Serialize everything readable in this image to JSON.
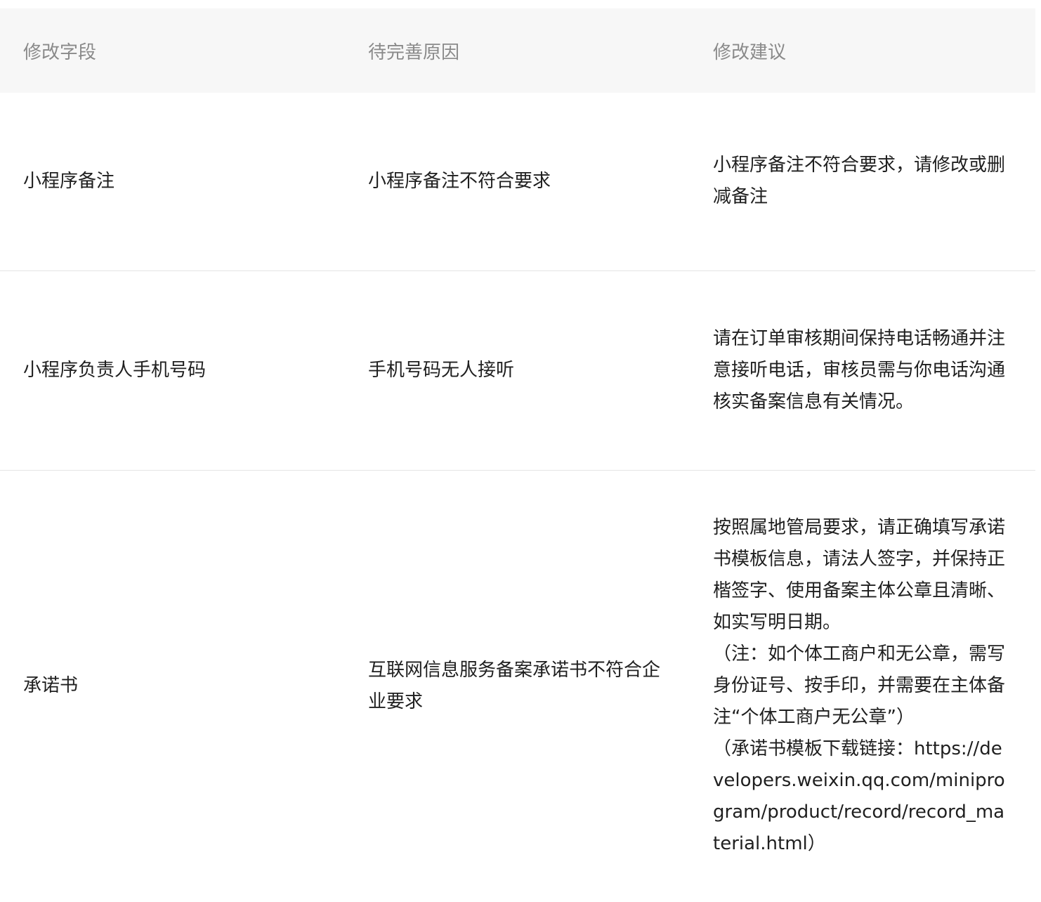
{
  "table": {
    "headers": [
      "修改字段",
      "待完善原因",
      "修改建议"
    ],
    "rows": [
      {
        "field": "小程序备注",
        "reason": "小程序备注不符合要求",
        "suggestion": "小程序备注不符合要求，请修改或删减备注"
      },
      {
        "field": "小程序负责人手机号码",
        "reason": "手机号码无人接听",
        "suggestion": "请在订单审核期间保持电话畅通并注意接听电话，审核员需与你电话沟通核实备案信息有关情况。"
      },
      {
        "field": "承诺书",
        "reason": "互联网信息服务备案承诺书不符合企业要求",
        "suggestion_lines": [
          "按照属地管局要求，请正确填写承诺书模板信息，请法人签字，并保持正楷签字、使用备案主体公章且清晰、如实写明日期。",
          "（注：如个体工商户和无公章，需写身份证号、按手印，并需要在主体备注“个体工商户无公章”）",
          "（承诺书模板下载链接：https://developers.weixin.qq.com/miniprogram/product/record/record_material.html）"
        ]
      }
    ]
  }
}
